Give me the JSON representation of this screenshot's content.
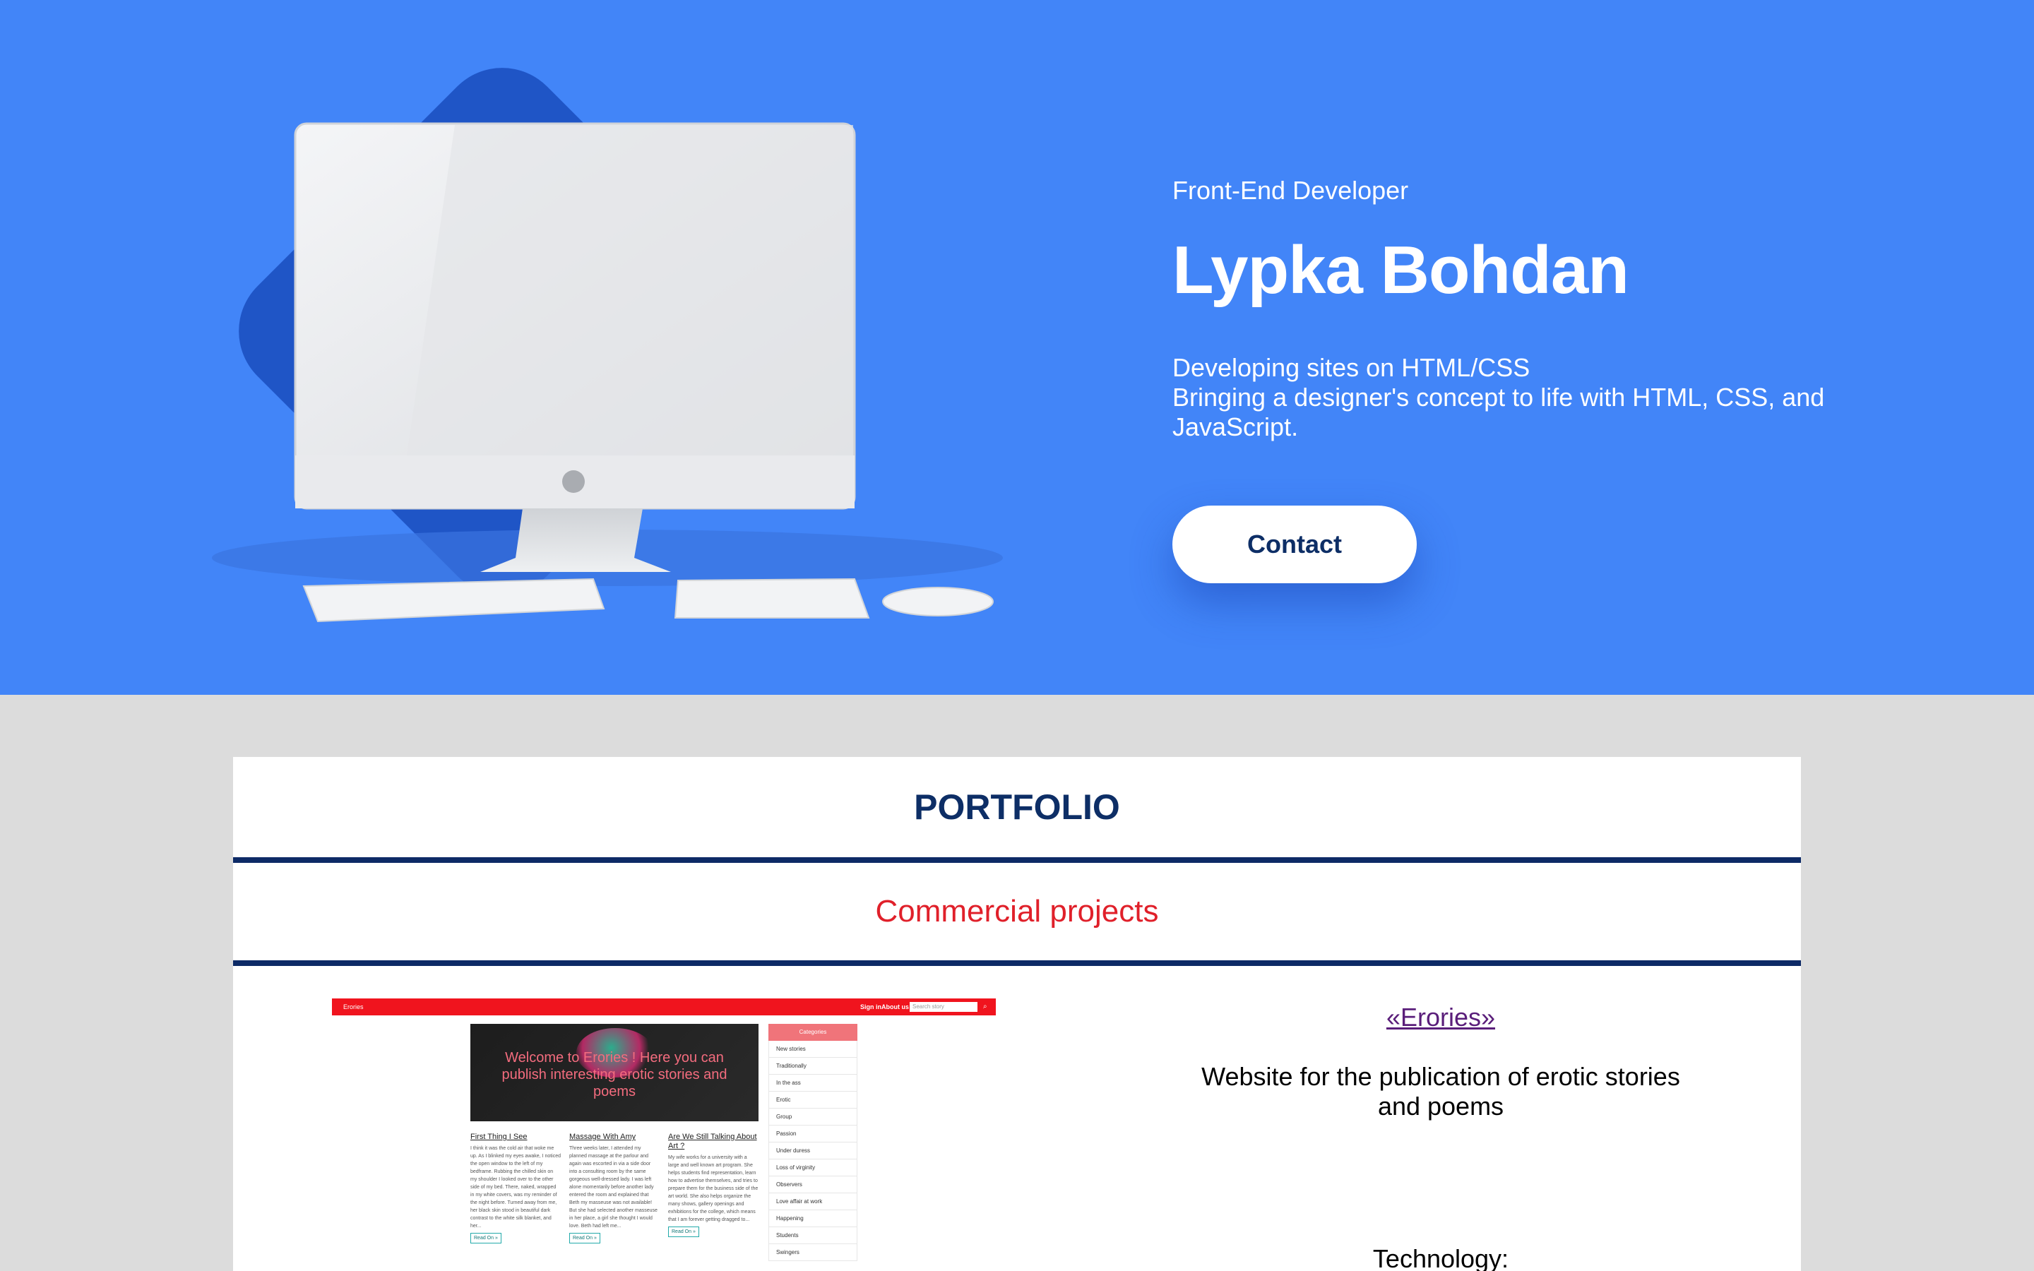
{
  "hero": {
    "role": "Front-End Developer",
    "name": "Lypka Bohdan",
    "desc_line1": "Developing sites on HTML/CSS",
    "desc_line2": "Bringing a designer's concept to life with HTML, CSS, and JavaScript.",
    "contact_label": "Contact",
    "illustration": "desktop-computer-with-keyboard-trackpad-mouse"
  },
  "portfolio": {
    "title": "PORTFOLIO",
    "section": "Commercial projects",
    "project": {
      "name": "«Erories»",
      "description": "Website for the publication of erotic stories and poems",
      "technology_label": "Technology:",
      "screenshot": {
        "brand": "Erories",
        "nav_signin": "Sign in",
        "nav_about": "About us",
        "search_placeholder": "Search story",
        "banner_text": "Welcome to Erories ! Here you can publish interesting erotic stories and poems",
        "categories_title": "Categories",
        "categories": [
          "New stories",
          "Traditionally",
          "In the ass",
          "Erotic",
          "Group",
          "Passion",
          "Under duress",
          "Loss of virginity",
          "Observers",
          "Love affair at work",
          "Happening",
          "Students",
          "Swingers"
        ],
        "articles": [
          {
            "title": "First Thing I See",
            "excerpt": "I think it was the cold air that woke me up. As I blinked my eyes awake, I noticed the open window to the left of my bedframe. Rubbing the chilled skin on my shoulder I looked over to the other side of my bed. There, naked, wrapped in my white covers, was my reminder of the night before. Turned away from me, her black skin stood in beautiful dark contrast to the white silk blanket, and her...",
            "more": "Read On »"
          },
          {
            "title": "Massage With Amy",
            "excerpt": "Three weeks later, I attended my planned massage at the parlour and again was escorted in via a side door into a consulting room by the same gorgeous well-dressed lady. I was left alone momentarily before another lady entered the room and explained that Beth my masseuse was not available! But she had selected another masseuse in her place, a girl she thought I would love. Beth had left me...",
            "more": "Read On »"
          },
          {
            "title": "Are We Still Talking About Art ?",
            "excerpt": "My wife works for a university with a large and well known art program. She helps students find representation, learn how to advertise themselves, and tries to prepare them for the business side of the art world. She also helps organize the many shows, gallery openings and exhibitions for the college, which means that I am forever getting dragged to...",
            "more": "Read On »"
          }
        ]
      }
    }
  },
  "colors": {
    "hero_bg": "#4285f8",
    "accent_navy": "#0d2e66",
    "section_red": "#e0202a",
    "page_bg": "#dcdcdc"
  }
}
